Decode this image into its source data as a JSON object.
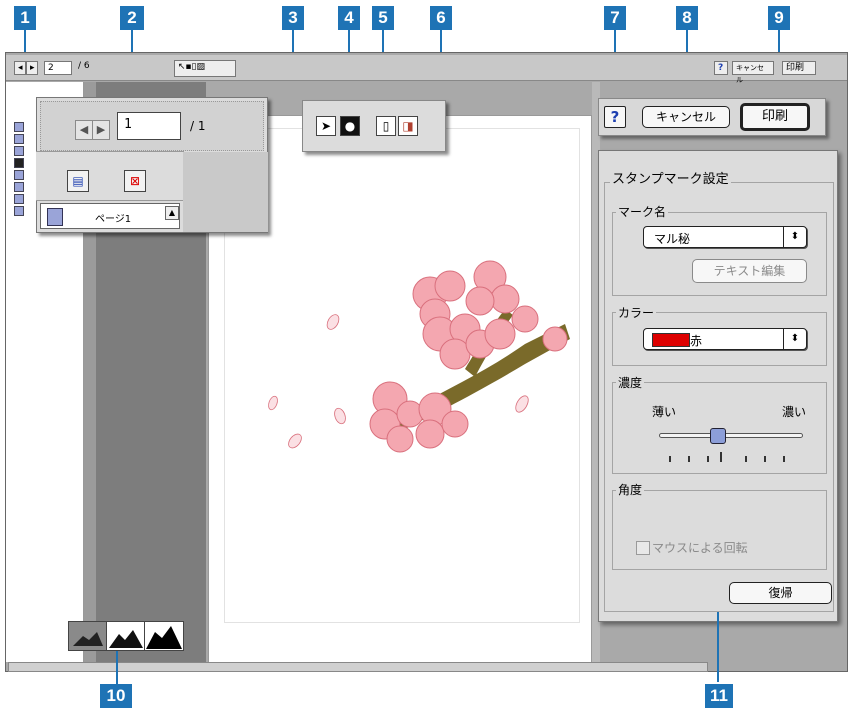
{
  "callouts": [
    "1",
    "2",
    "3",
    "4",
    "5",
    "6",
    "7",
    "8",
    "9",
    "10",
    "11"
  ],
  "topbar": {
    "page_input": "2",
    "page_total": "/ 6",
    "help_label": "?",
    "cancel_label": "キャンセル",
    "print_label": "印刷"
  },
  "page_panel": {
    "page_number": "1",
    "page_total": "/ 1",
    "page_item_label": "ページ1"
  },
  "tools": {
    "arrow_icon": "arrow-icon",
    "stamp_icon": "stamp-icon",
    "page_icon": "page-icon",
    "image_icon": "image-icon"
  },
  "actions": {
    "help_label": "?",
    "cancel_label": "キャンセル",
    "print_label": "印刷"
  },
  "stamp_panel": {
    "title": "スタンプマーク設定",
    "mark_name_label": "マーク名",
    "mark_name_value": "マル秘",
    "text_edit_label": "テキスト編集",
    "color_label": "カラー",
    "color_value": "赤",
    "color_swatch": "#dd0000",
    "density_label": "濃度",
    "density_low": "薄い",
    "density_high": "濃い",
    "density_level": 0.4,
    "angle_label": "角度",
    "mouse_rotate_label": "マウスによる回転",
    "reset_label": "復帰"
  },
  "colors": {
    "callout": "#1e73b5",
    "blossom": "#f4a7b0",
    "branch": "#7a6a2a"
  }
}
